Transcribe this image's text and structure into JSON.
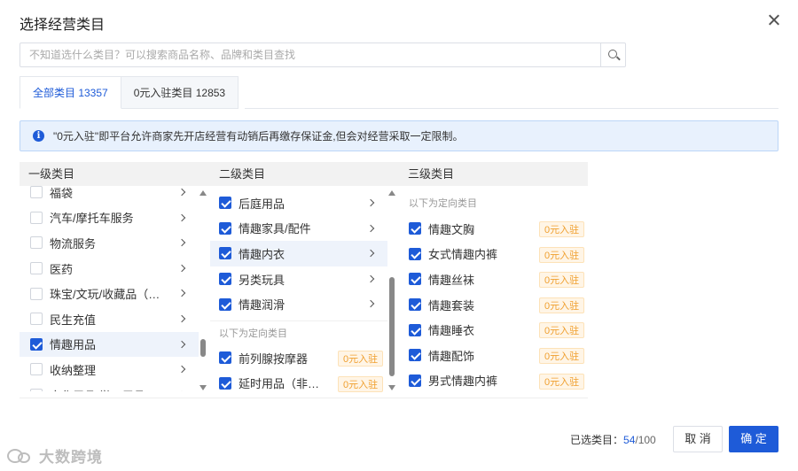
{
  "dialog": {
    "title": "选择经营类目"
  },
  "search": {
    "placeholder": "不知道选什么类目？可以搜索商品名称、品牌和类目查找"
  },
  "tabs": [
    {
      "label": "全部类目 13357"
    },
    {
      "label": "0元入驻类目 12853"
    }
  ],
  "notice": {
    "text": "\"0元入驻\"即平台允许商家先开店经营有动销后再缴存保证金,但会对经营采取一定限制。"
  },
  "columns": {
    "level1": {
      "header": "一级类目",
      "items": [
        {
          "label": "福袋",
          "checked": false
        },
        {
          "label": "汽车/摩托车服务",
          "checked": false
        },
        {
          "label": "物流服务",
          "checked": false
        },
        {
          "label": "医药",
          "checked": false
        },
        {
          "label": "珠宝/文玩/收藏品（定...",
          "checked": false
        },
        {
          "label": "民生充值",
          "checked": false
        },
        {
          "label": "情趣用品",
          "checked": true
        },
        {
          "label": "收纳整理",
          "checked": false
        },
        {
          "label": "文化用品/学习用具",
          "checked": false
        }
      ]
    },
    "level2": {
      "header": "二级类目",
      "items": [
        {
          "label": "后庭用品",
          "checked": true
        },
        {
          "label": "情趣家具/配件",
          "checked": true
        },
        {
          "label": "情趣内衣",
          "checked": true
        },
        {
          "label": "另类玩具",
          "checked": true
        },
        {
          "label": "情趣润滑",
          "checked": true
        }
      ],
      "sub_heading": "以下为定向类目",
      "directed_items": [
        {
          "label": "前列腺按摩器",
          "checked": true,
          "badge": "0元入驻"
        },
        {
          "label": "延时用品（非药...",
          "checked": true,
          "badge": "0元入驻"
        }
      ]
    },
    "level3": {
      "header": "三级类目",
      "sub_heading": "以下为定向类目",
      "items": [
        {
          "label": "情趣文胸",
          "checked": true,
          "badge": "0元入驻"
        },
        {
          "label": "女式情趣内裤",
          "checked": true,
          "badge": "0元入驻"
        },
        {
          "label": "情趣丝袜",
          "checked": true,
          "badge": "0元入驻"
        },
        {
          "label": "情趣套装",
          "checked": true,
          "badge": "0元入驻"
        },
        {
          "label": "情趣睡衣",
          "checked": true,
          "badge": "0元入驻"
        },
        {
          "label": "情趣配饰",
          "checked": true,
          "badge": "0元入驻"
        },
        {
          "label": "男式情趣内裤",
          "checked": true,
          "badge": "0元入驻"
        }
      ]
    }
  },
  "footer": {
    "selected_label": "已选类目：",
    "selected_count": "54",
    "selected_total": "/100",
    "cancel_label": "取 消",
    "ok_label": "确 定"
  },
  "watermark": {
    "text": "大数跨境"
  },
  "colors": {
    "accent": "#1e5bd8",
    "badge_text": "#f0a030",
    "notice_bg": "#e8f1fd"
  }
}
